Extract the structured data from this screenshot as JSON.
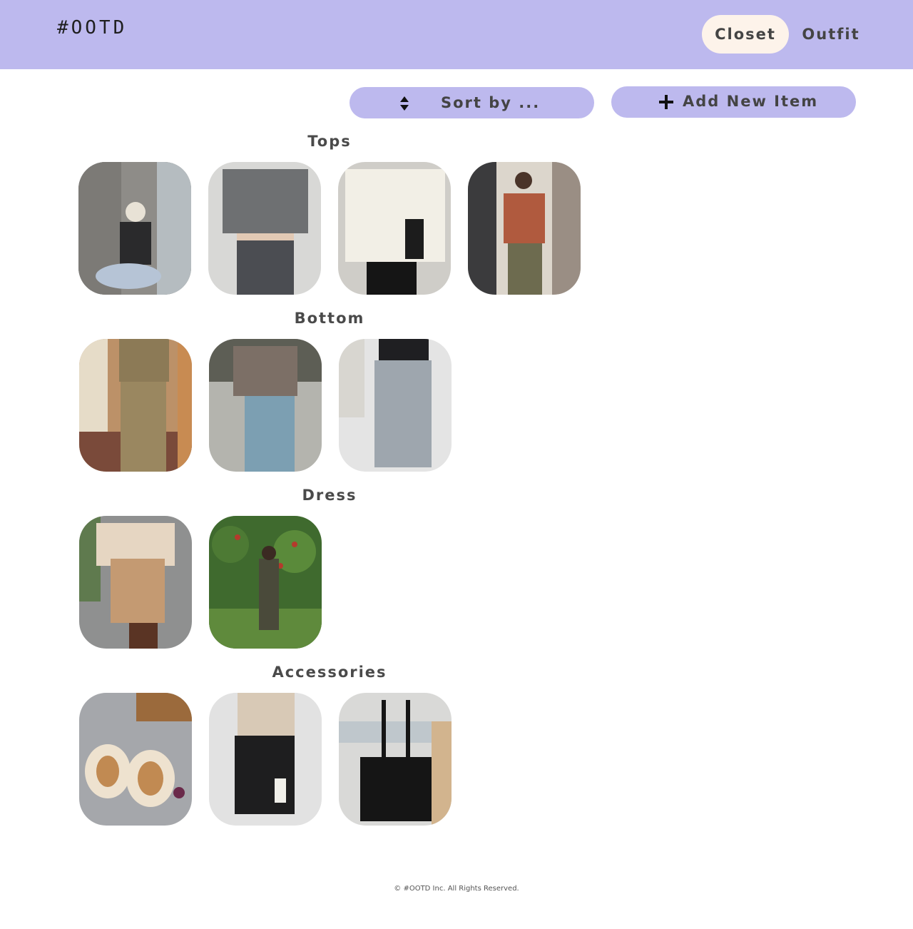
{
  "header": {
    "logo": "#OOTD",
    "nav": {
      "closet": "Closet",
      "outfit": "Outfit"
    }
  },
  "toolbar": {
    "sort_label": "Sort by ...",
    "add_label": "Add New Item"
  },
  "sections": {
    "tops": {
      "title": "Tops"
    },
    "bottom": {
      "title": "Bottom"
    },
    "dress": {
      "title": "Dress"
    },
    "accessories": {
      "title": "Accessories"
    }
  },
  "colors": {
    "header_bg": "#bdb9ee",
    "active_nav_bg": "#fdf3ea",
    "button_bg": "#bdb9ee"
  },
  "footer": {
    "text": "© #OOTD Inc. All Rights Reserved."
  }
}
